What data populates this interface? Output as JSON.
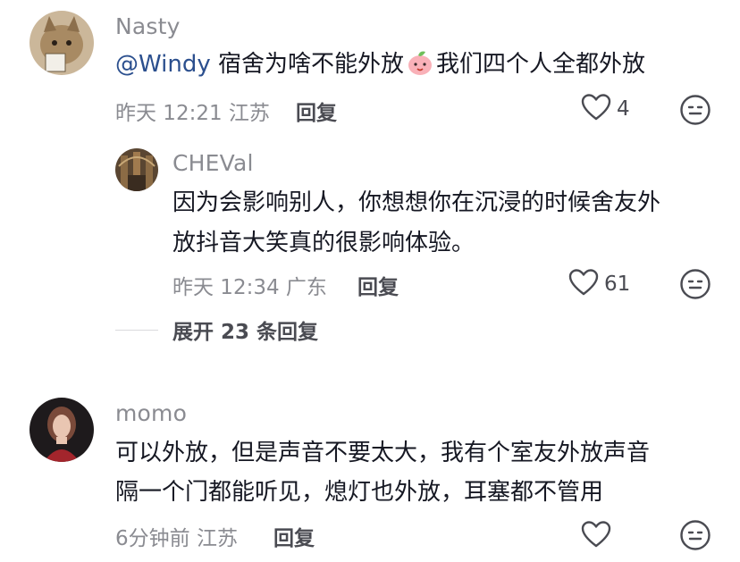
{
  "comments": [
    {
      "username": "Nasty",
      "mention": "@Windy",
      "text_before_emoji": " 宿舍为啥不能外放",
      "emoji": "peach-face-emoji",
      "text_after_emoji": "我们四个人全都外放",
      "meta": "昨天 12:21 江苏",
      "reply_label": "回复",
      "like_count": "4",
      "reply": {
        "username": "CHEVal",
        "text_line1": "因为会影响别人，你想想你在沉浸的时候舍友外",
        "text_line2": "放抖音大笑真的很影响体验。",
        "meta": "昨天 12:34 广东",
        "reply_label": "回复",
        "like_count": "61"
      },
      "expand_label": "展开 23 条回复"
    },
    {
      "username": "momo",
      "text_line1": "可以外放，但是声音不要太大，我有个室友外放声音",
      "text_line2": "隔一个门都能听见，熄灯也外放，耳塞都不管用",
      "meta": "6分钟前 江苏",
      "reply_label": "回复",
      "like_count": ""
    }
  ],
  "icons": {
    "like": "heart-outline-icon",
    "emoji": "smiley-icon"
  },
  "colors": {
    "text": "#161823",
    "secondary": "#8a8b91",
    "mention": "#2b4f8e"
  }
}
